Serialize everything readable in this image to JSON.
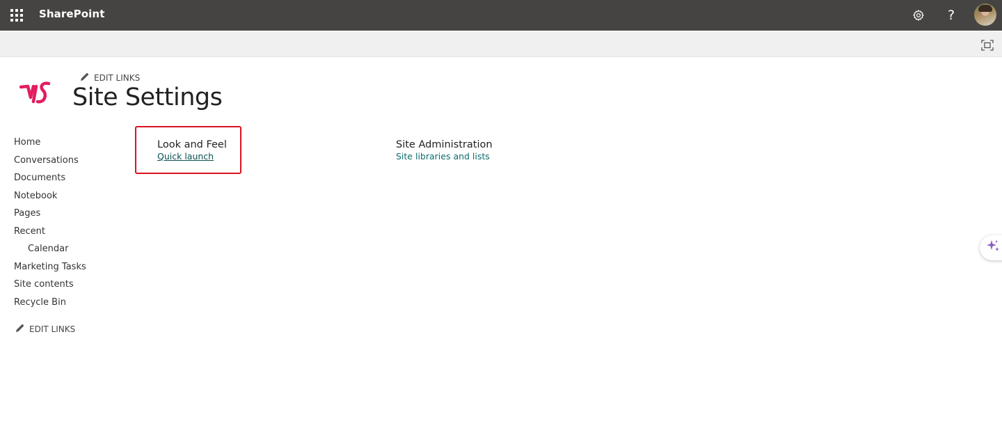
{
  "suite_bar": {
    "app_name": "SharePoint",
    "icons": [
      "waffle-icon",
      "gear-icon",
      "help-icon",
      "avatar"
    ],
    "help_glyph": "?",
    "background": "#464442"
  },
  "ribbon": {
    "focus_icon": "focus-mode-icon"
  },
  "header": {
    "edit_links": "EDIT LINKS",
    "title": "Site Settings",
    "logo_color": "#e31c5f"
  },
  "left_nav": {
    "items": [
      {
        "label": "Home"
      },
      {
        "label": "Conversations"
      },
      {
        "label": "Documents"
      },
      {
        "label": "Notebook"
      },
      {
        "label": "Pages"
      },
      {
        "label": "Recent"
      },
      {
        "label": "Calendar"
      },
      {
        "label": "Marketing Tasks"
      },
      {
        "label": "Site contents"
      },
      {
        "label": "Recycle Bin"
      }
    ],
    "edit_links": "EDIT LINKS"
  },
  "sections": [
    {
      "heading": "Look and Feel",
      "links": [
        "Quick launch"
      ]
    },
    {
      "heading": "Site Administration",
      "links": [
        "Site libraries and lists"
      ]
    }
  ],
  "colors": {
    "link": "#0f6b6b",
    "highlight": "#d9121d",
    "copilot": "#8a5cc4"
  }
}
